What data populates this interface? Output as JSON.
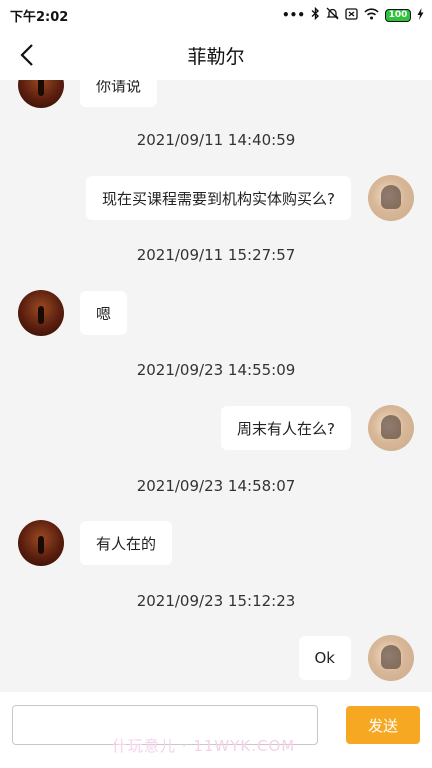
{
  "status_bar": {
    "time": "下午2:02",
    "battery_level": "100",
    "icons": [
      "dots-icon",
      "bluetooth-icon",
      "mute-icon",
      "sim-off-icon",
      "wifi-icon",
      "battery-icon",
      "charging-icon"
    ]
  },
  "header": {
    "title": "菲勒尔",
    "back_icon": "chevron-left-icon"
  },
  "messages": [
    {
      "side": "left",
      "text": "你请说"
    },
    {
      "timestamp": "2021/09/11 14:40:59"
    },
    {
      "side": "right",
      "text": "现在买课程需要到机构实体购买么?"
    },
    {
      "timestamp": "2021/09/11 15:27:57"
    },
    {
      "side": "left",
      "text": "嗯"
    },
    {
      "timestamp": "2021/09/23 14:55:09"
    },
    {
      "side": "right",
      "text": "周末有人在么?"
    },
    {
      "timestamp": "2021/09/23 14:58:07"
    },
    {
      "side": "left",
      "text": "有人在的"
    },
    {
      "timestamp": "2021/09/23 15:12:23"
    },
    {
      "side": "right",
      "text": "Ok"
    }
  ],
  "input_bar": {
    "placeholder": "",
    "send_label": "发送"
  },
  "watermark": "什玩意儿 · 11WYK.COM",
  "colors": {
    "send_button": "#f7a823",
    "page_background": "#f4f4f4",
    "bubble": "#ffffff"
  }
}
